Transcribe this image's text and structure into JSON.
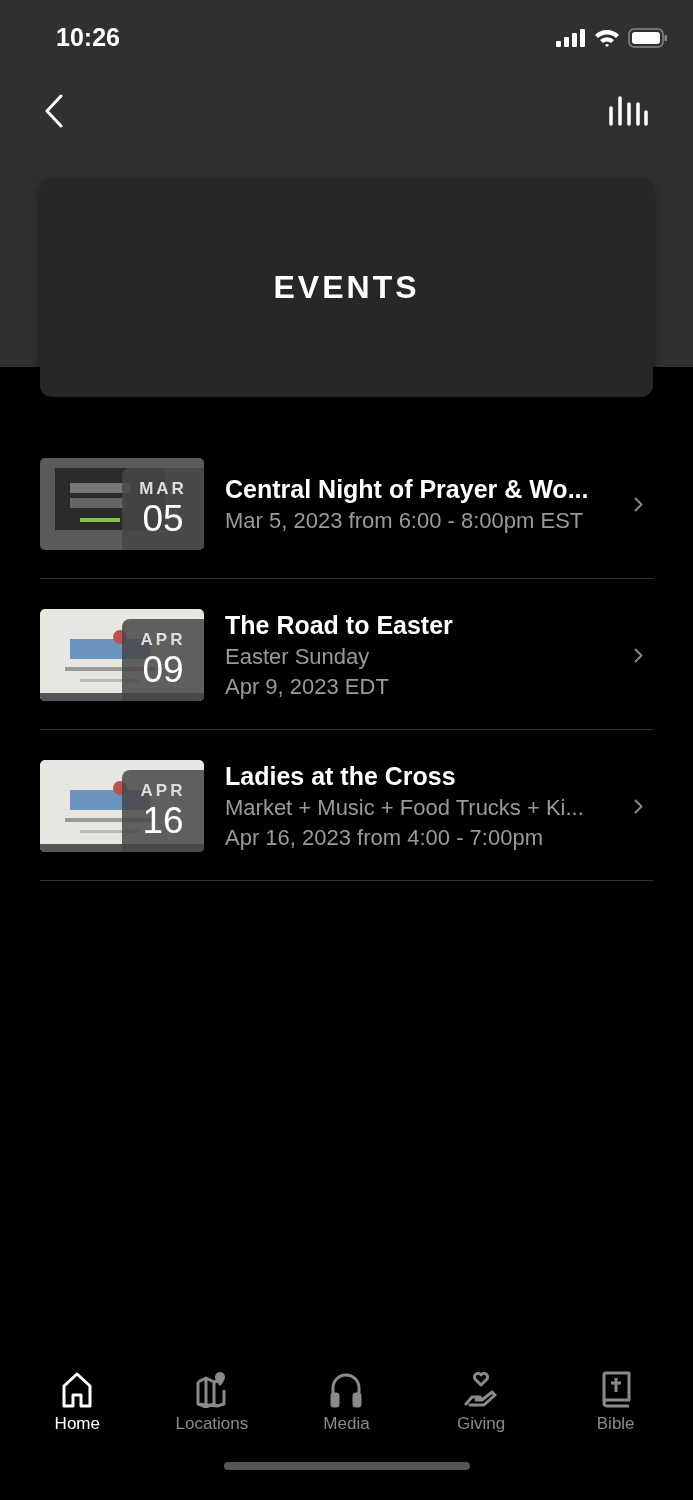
{
  "status_bar": {
    "time": "10:26"
  },
  "banner": {
    "title": "EVENTS"
  },
  "events": [
    {
      "month": "MAR",
      "day": "05",
      "title": "Central Night of Prayer & Wo...",
      "lines": [
        "Mar 5, 2023 from 6:00 - 8:00pm EST"
      ]
    },
    {
      "month": "APR",
      "day": "09",
      "title": "The Road to Easter",
      "lines": [
        "Easter Sunday",
        "Apr 9, 2023 EDT"
      ]
    },
    {
      "month": "APR",
      "day": "16",
      "title": "Ladies at the Cross",
      "lines": [
        "Market + Music + Food Trucks + Ki...",
        "Apr 16, 2023 from 4:00 - 7:00pm"
      ]
    }
  ],
  "tabs": [
    {
      "label": "Home",
      "selected": true
    },
    {
      "label": "Locations",
      "selected": false
    },
    {
      "label": "Media",
      "selected": false
    },
    {
      "label": "Giving",
      "selected": false
    },
    {
      "label": "Bible",
      "selected": false
    }
  ]
}
